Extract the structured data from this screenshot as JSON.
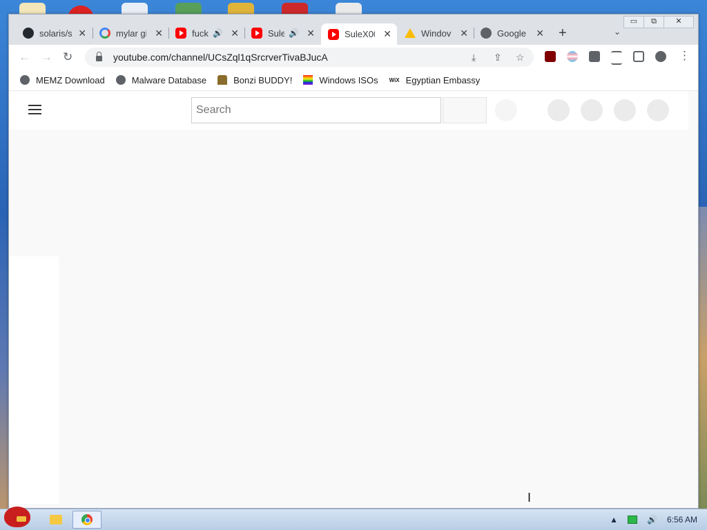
{
  "tabs": [
    {
      "title": "solaris/s",
      "icon": "github-icon",
      "audio": false
    },
    {
      "title": "mylar gi",
      "icon": "google-icon",
      "audio": false
    },
    {
      "title": "fuck",
      "icon": "youtube-icon",
      "audio": true
    },
    {
      "title": "Sule",
      "icon": "youtube-icon",
      "audio": true
    },
    {
      "title": "SuleX00",
      "icon": "youtube-icon",
      "audio": false,
      "active": true
    },
    {
      "title": "Windov",
      "icon": "drive-icon",
      "audio": false
    },
    {
      "title": "Google",
      "icon": "globe-icon",
      "audio": false
    }
  ],
  "window_controls": {
    "minimize": "▭",
    "maximize": "⧉",
    "close": "✕"
  },
  "toolbar": {
    "back": "←",
    "forward": "→",
    "reload": "↻",
    "url": "youtube.com/channel/UCsZql1qSrcrverTivaBJucA",
    "new_tab": "+",
    "tab_menu": "⌄"
  },
  "bookmarks": [
    {
      "label": "MEMZ Download",
      "icon": "globe-icon"
    },
    {
      "label": "Malware Database",
      "icon": "globe-icon"
    },
    {
      "label": "Bonzi BUDDY!",
      "icon": "bonzi-icon"
    },
    {
      "label": "Windows ISOs",
      "icon": "rainbow-flag-icon"
    },
    {
      "label": "Egyptian Embassy",
      "icon": "wix-icon",
      "icon_text": "WiX"
    }
  ],
  "youtube": {
    "search_placeholder": "Search"
  },
  "taskbar": {
    "clock": "6:56 AM"
  }
}
